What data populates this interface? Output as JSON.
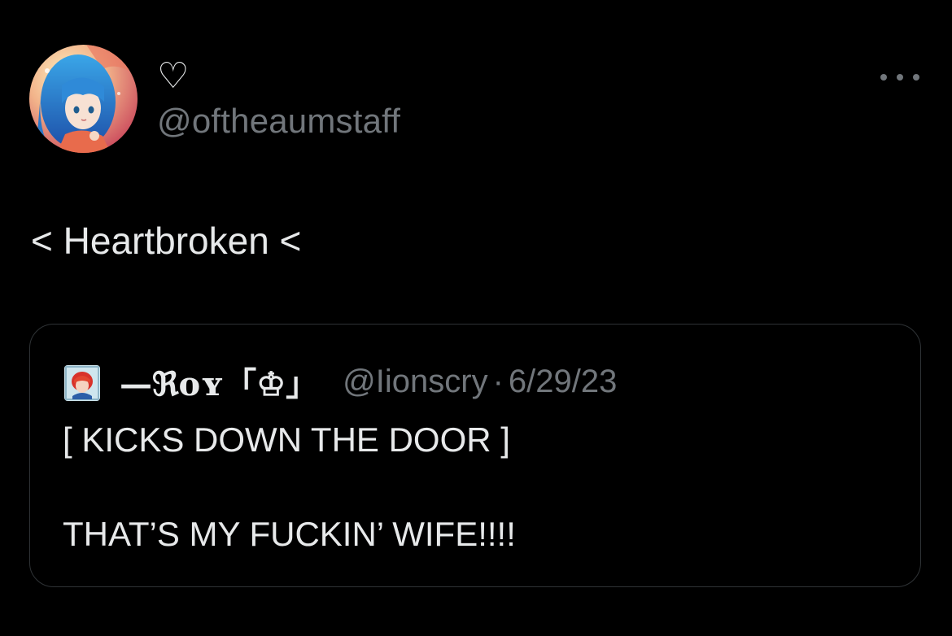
{
  "tweet": {
    "display_name": "♡",
    "handle": "@oftheaumstaff",
    "text": "< Heartbroken <",
    "avatar_icon": "anime-character-avatar",
    "more_icon": "more-dots-icon"
  },
  "quote": {
    "author_name": "—ℜoʏ「♔」",
    "handle": "@Iionscry",
    "separator": "·",
    "date": "6/29/23",
    "line1": "[ KICKS DOWN THE DOOR ]",
    "line2": "THAT’S MY FUCKIN’ WIFE!!!!",
    "avatar_icon": "anime-character-avatar"
  },
  "colors": {
    "background": "#000000",
    "primary_text": "#e7e9ea",
    "secondary_text": "#71767b",
    "border": "#2f3336"
  }
}
